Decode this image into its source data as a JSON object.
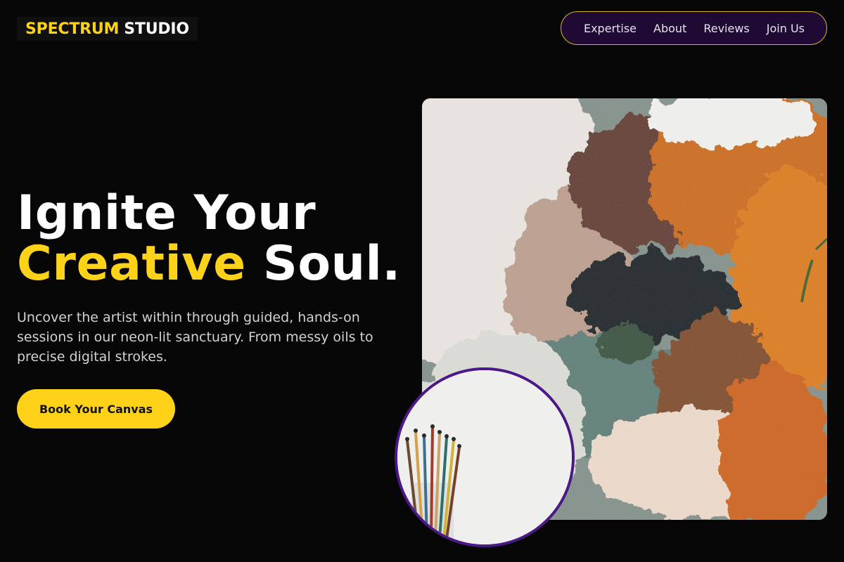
{
  "brand": {
    "name_accent": "SPECTRUM",
    "name_rest": "STUDIO"
  },
  "nav": {
    "items": [
      "Expertise",
      "About",
      "Reviews",
      "Join Us"
    ]
  },
  "hero": {
    "title_line1": "Ignite Your",
    "title_accent": "Creative",
    "title_rest": "Soul.",
    "subtitle": "Uncover the artist within through guided, hands-on sessions in our neon-lit sanctuary. From messy oils to precise digital strokes.",
    "cta_label": "Book Your Canvas"
  },
  "images": {
    "main": "textured-oil-paint-photo",
    "inset": "paint-brushes-in-jar-photo"
  },
  "colors": {
    "accent_yellow": "#ffd21a",
    "background": "#060606",
    "nav_background": "#1e0a33",
    "inset_border": "#4b1887"
  }
}
